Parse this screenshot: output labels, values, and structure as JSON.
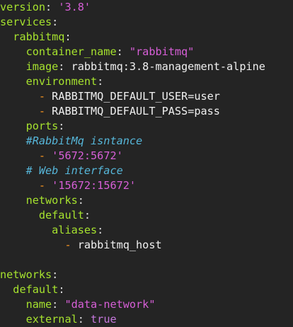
{
  "editor": {
    "language": "yaml",
    "colors": {
      "background": "#242424",
      "key": "#a6e22e",
      "punctuation": "#e0e0e0",
      "list_dash": "#fd971f",
      "string": "#d75fd7",
      "plain_scalar": "#f0f0f0",
      "comment": "#56b6d9",
      "boolean": "#c678dd"
    },
    "lines": [
      {
        "indent": "",
        "tokens": [
          {
            "t": "version",
            "c": "key"
          },
          {
            "t": ": ",
            "c": "punc"
          },
          {
            "t": "'3.8'",
            "c": "str"
          }
        ]
      },
      {
        "indent": "",
        "tokens": [
          {
            "t": "services",
            "c": "key"
          },
          {
            "t": ":",
            "c": "punc"
          }
        ]
      },
      {
        "indent": "  ",
        "tokens": [
          {
            "t": "rabbitmq",
            "c": "key"
          },
          {
            "t": ":",
            "c": "punc"
          }
        ]
      },
      {
        "indent": "    ",
        "tokens": [
          {
            "t": "container_name",
            "c": "key"
          },
          {
            "t": ": ",
            "c": "punc"
          },
          {
            "t": "\"rabbitmq\"",
            "c": "str"
          }
        ]
      },
      {
        "indent": "    ",
        "tokens": [
          {
            "t": "image",
            "c": "key"
          },
          {
            "t": ": ",
            "c": "punc"
          },
          {
            "t": "rabbitmq:3.8-management-alpine",
            "c": "plain"
          }
        ]
      },
      {
        "indent": "    ",
        "tokens": [
          {
            "t": "environment",
            "c": "key"
          },
          {
            "t": ":",
            "c": "punc"
          }
        ]
      },
      {
        "indent": "      ",
        "tokens": [
          {
            "t": "- ",
            "c": "dash"
          },
          {
            "t": "RABBITMQ_DEFAULT_USER=user",
            "c": "plain"
          }
        ]
      },
      {
        "indent": "      ",
        "tokens": [
          {
            "t": "- ",
            "c": "dash"
          },
          {
            "t": "RABBITMQ_DEFAULT_PASS=pass",
            "c": "plain"
          }
        ]
      },
      {
        "indent": "    ",
        "tokens": [
          {
            "t": "ports",
            "c": "key"
          },
          {
            "t": ":",
            "c": "punc"
          }
        ]
      },
      {
        "indent": "    ",
        "tokens": [
          {
            "t": "#RabbitMq isntance",
            "c": "comm"
          }
        ]
      },
      {
        "indent": "      ",
        "tokens": [
          {
            "t": "- ",
            "c": "dash"
          },
          {
            "t": "'5672:5672'",
            "c": "str"
          }
        ]
      },
      {
        "indent": "    ",
        "tokens": [
          {
            "t": "# Web interface",
            "c": "comm"
          }
        ]
      },
      {
        "indent": "      ",
        "tokens": [
          {
            "t": "- ",
            "c": "dash"
          },
          {
            "t": "'15672:15672'",
            "c": "str"
          }
        ]
      },
      {
        "indent": "    ",
        "tokens": [
          {
            "t": "networks",
            "c": "key"
          },
          {
            "t": ":",
            "c": "punc"
          }
        ]
      },
      {
        "indent": "      ",
        "tokens": [
          {
            "t": "default",
            "c": "key"
          },
          {
            "t": ":",
            "c": "punc"
          }
        ]
      },
      {
        "indent": "        ",
        "tokens": [
          {
            "t": "aliases",
            "c": "key"
          },
          {
            "t": ":",
            "c": "punc"
          }
        ]
      },
      {
        "indent": "          ",
        "tokens": [
          {
            "t": "- ",
            "c": "dash"
          },
          {
            "t": "rabbitmq_host",
            "c": "plain"
          }
        ]
      },
      {
        "indent": "",
        "tokens": []
      },
      {
        "indent": "",
        "tokens": [
          {
            "t": "networks",
            "c": "key"
          },
          {
            "t": ":",
            "c": "punc"
          }
        ]
      },
      {
        "indent": "  ",
        "tokens": [
          {
            "t": "default",
            "c": "key"
          },
          {
            "t": ":",
            "c": "punc"
          }
        ]
      },
      {
        "indent": "    ",
        "tokens": [
          {
            "t": "name",
            "c": "key"
          },
          {
            "t": ": ",
            "c": "punc"
          },
          {
            "t": "\"data-network\"",
            "c": "str"
          }
        ]
      },
      {
        "indent": "    ",
        "tokens": [
          {
            "t": "external",
            "c": "key"
          },
          {
            "t": ": ",
            "c": "punc"
          },
          {
            "t": "true",
            "c": "bool"
          }
        ]
      }
    ]
  }
}
